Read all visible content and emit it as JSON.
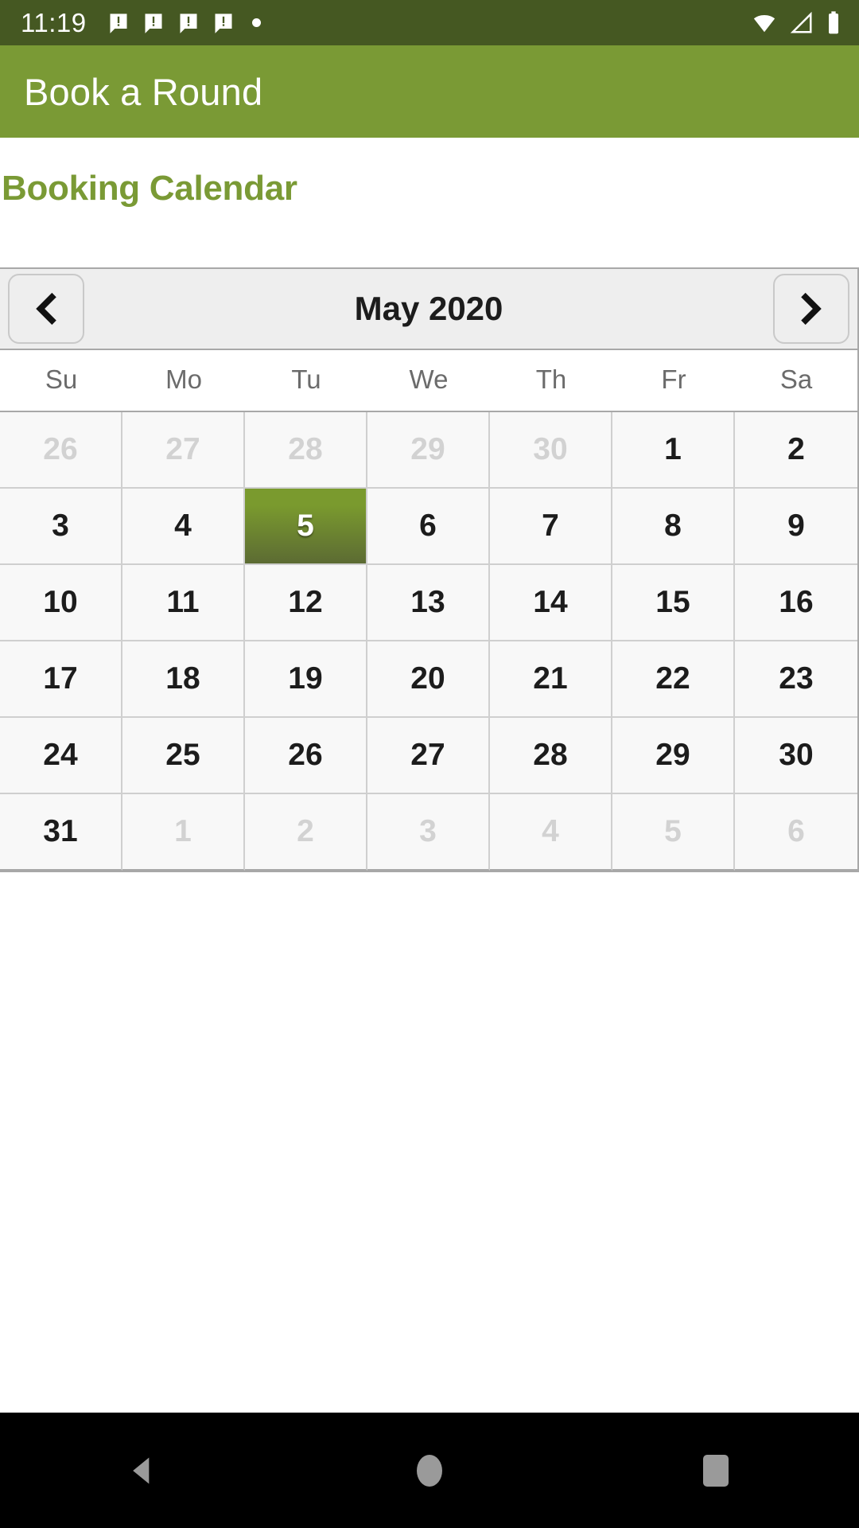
{
  "status_bar": {
    "time": "11:19",
    "notification_icons": [
      "message-alert-icon",
      "message-alert-icon",
      "message-alert-icon",
      "message-alert-icon",
      "dot-icon"
    ],
    "system_icons": [
      "wifi-icon",
      "cell-signal-icon",
      "battery-icon"
    ],
    "background_color": "#455822",
    "foreground_color": "#ffffff"
  },
  "app_bar": {
    "title": "Book a Round",
    "background_color": "#7a9a35",
    "text_color": "#ffffff"
  },
  "page": {
    "heading": "Booking Calendar",
    "heading_color": "#7a9a35",
    "background_color": "#ffffff"
  },
  "calendar": {
    "month_label": "May 2020",
    "prev_icon": "chevron-left-icon",
    "next_icon": "chevron-right-icon",
    "header_background": "#eeeeee",
    "selected_color": "#7a9a2e",
    "muted_color": "#d2d2d2",
    "weekdays": [
      "Su",
      "Mo",
      "Tu",
      "We",
      "Th",
      "Fr",
      "Sa"
    ],
    "selected_day": "5",
    "weeks": [
      [
        {
          "label": "26",
          "muted": true,
          "selected": false
        },
        {
          "label": "27",
          "muted": true,
          "selected": false
        },
        {
          "label": "28",
          "muted": true,
          "selected": false
        },
        {
          "label": "29",
          "muted": true,
          "selected": false
        },
        {
          "label": "30",
          "muted": true,
          "selected": false
        },
        {
          "label": "1",
          "muted": false,
          "selected": false
        },
        {
          "label": "2",
          "muted": false,
          "selected": false
        }
      ],
      [
        {
          "label": "3",
          "muted": false,
          "selected": false
        },
        {
          "label": "4",
          "muted": false,
          "selected": false
        },
        {
          "label": "5",
          "muted": false,
          "selected": true
        },
        {
          "label": "6",
          "muted": false,
          "selected": false
        },
        {
          "label": "7",
          "muted": false,
          "selected": false
        },
        {
          "label": "8",
          "muted": false,
          "selected": false
        },
        {
          "label": "9",
          "muted": false,
          "selected": false
        }
      ],
      [
        {
          "label": "10",
          "muted": false,
          "selected": false
        },
        {
          "label": "11",
          "muted": false,
          "selected": false
        },
        {
          "label": "12",
          "muted": false,
          "selected": false
        },
        {
          "label": "13",
          "muted": false,
          "selected": false
        },
        {
          "label": "14",
          "muted": false,
          "selected": false
        },
        {
          "label": "15",
          "muted": false,
          "selected": false
        },
        {
          "label": "16",
          "muted": false,
          "selected": false
        }
      ],
      [
        {
          "label": "17",
          "muted": false,
          "selected": false
        },
        {
          "label": "18",
          "muted": false,
          "selected": false
        },
        {
          "label": "19",
          "muted": false,
          "selected": false
        },
        {
          "label": "20",
          "muted": false,
          "selected": false
        },
        {
          "label": "21",
          "muted": false,
          "selected": false
        },
        {
          "label": "22",
          "muted": false,
          "selected": false
        },
        {
          "label": "23",
          "muted": false,
          "selected": false
        }
      ],
      [
        {
          "label": "24",
          "muted": false,
          "selected": false
        },
        {
          "label": "25",
          "muted": false,
          "selected": false
        },
        {
          "label": "26",
          "muted": false,
          "selected": false
        },
        {
          "label": "27",
          "muted": false,
          "selected": false
        },
        {
          "label": "28",
          "muted": false,
          "selected": false
        },
        {
          "label": "29",
          "muted": false,
          "selected": false
        },
        {
          "label": "30",
          "muted": false,
          "selected": false
        }
      ],
      [
        {
          "label": "31",
          "muted": false,
          "selected": false
        },
        {
          "label": "1",
          "muted": true,
          "selected": false
        },
        {
          "label": "2",
          "muted": true,
          "selected": false
        },
        {
          "label": "3",
          "muted": true,
          "selected": false
        },
        {
          "label": "4",
          "muted": true,
          "selected": false
        },
        {
          "label": "5",
          "muted": true,
          "selected": false
        },
        {
          "label": "6",
          "muted": true,
          "selected": false
        }
      ]
    ]
  },
  "nav_bar": {
    "background_color": "#000000",
    "icon_color": "#9a9a9a",
    "buttons": [
      "back-icon",
      "home-icon",
      "recents-icon"
    ]
  }
}
